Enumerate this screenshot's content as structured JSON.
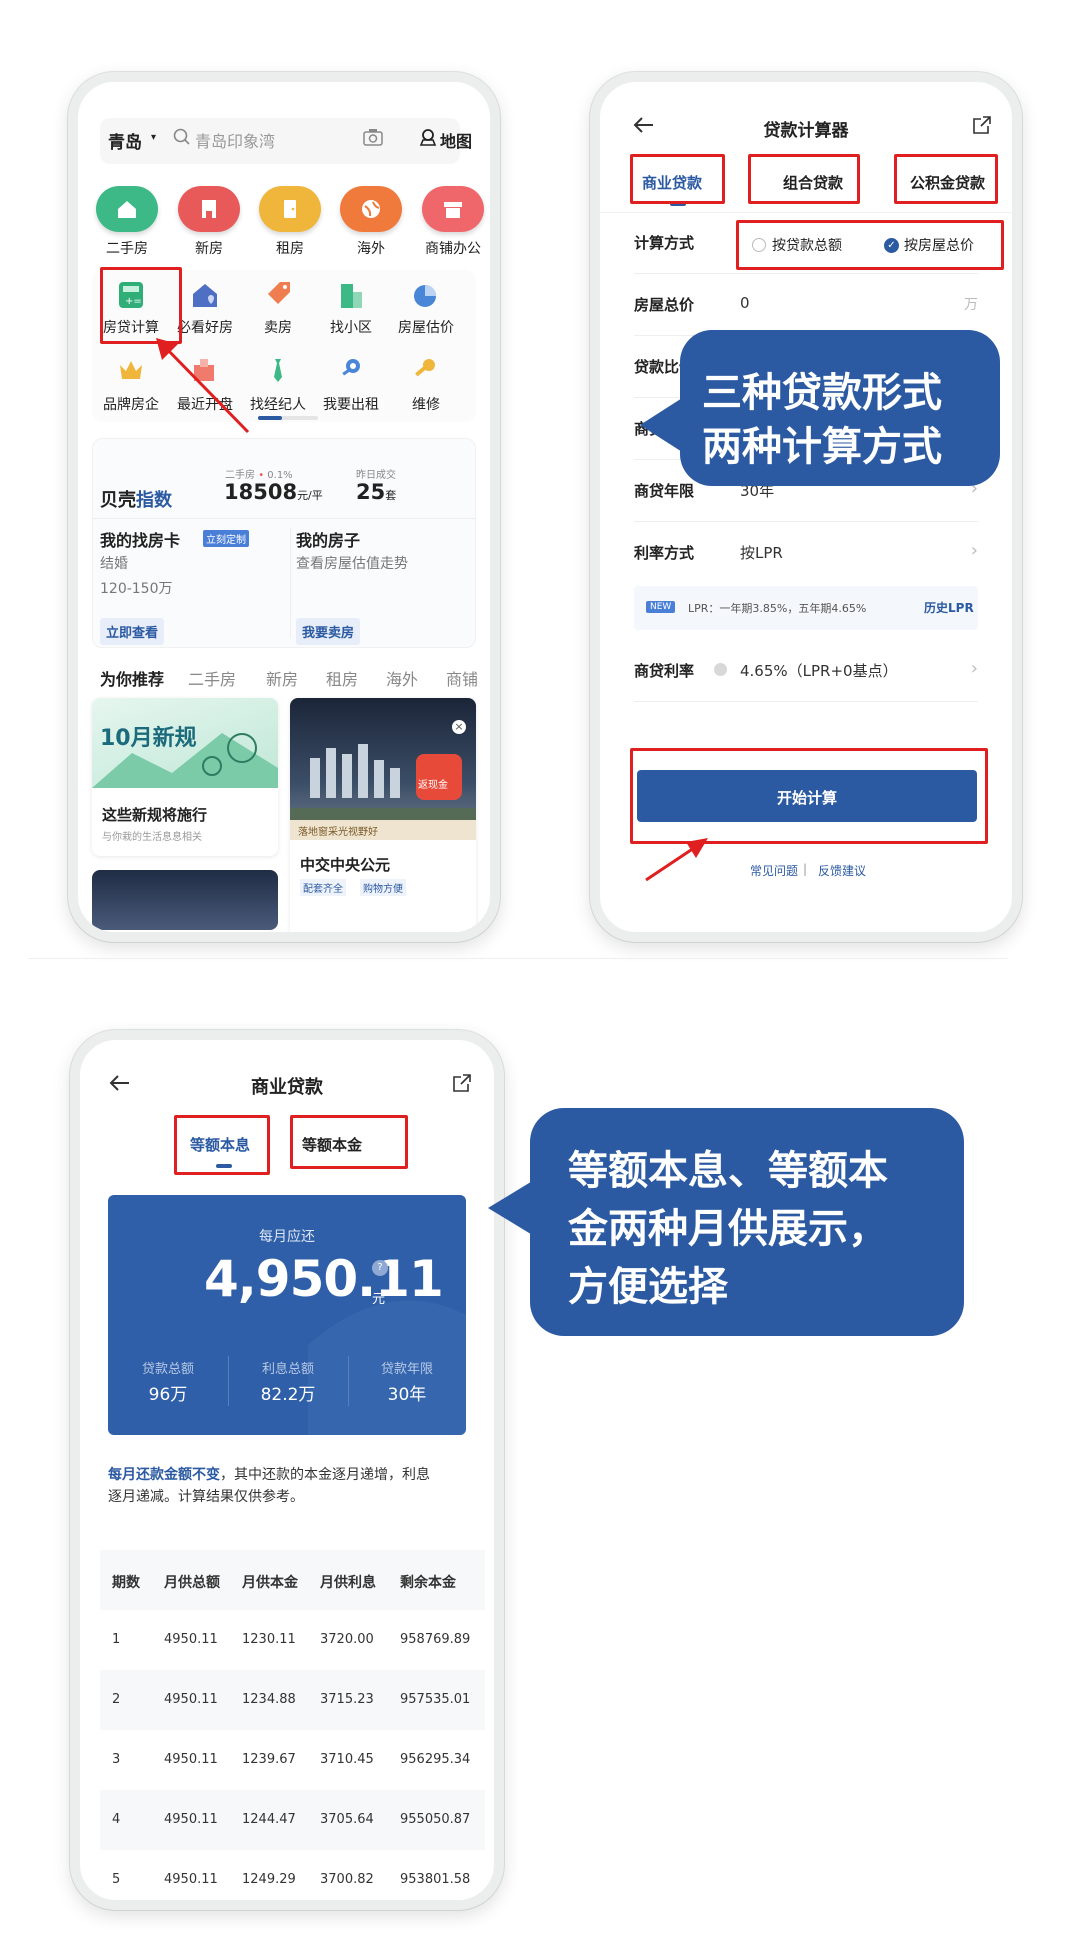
{
  "phone1": {
    "city": "青岛",
    "search_placeholder": "青岛印象湾",
    "map_label": "地图",
    "cats": [
      {
        "label": "二手房",
        "color": "#3db887",
        "icon": "house-icon"
      },
      {
        "label": "新房",
        "color": "#e85a5a",
        "icon": "building-icon"
      },
      {
        "label": "租房",
        "color": "#f0b63c",
        "icon": "door-icon"
      },
      {
        "label": "海外",
        "color": "#f07a3c",
        "icon": "globe-icon"
      },
      {
        "label": "商铺办公",
        "color": "#f0676b",
        "icon": "shop-icon"
      }
    ],
    "tools_row1": [
      {
        "label": "房贷计算",
        "icon": "calculator-icon"
      },
      {
        "label": "必看好房",
        "icon": "heart-house-icon"
      },
      {
        "label": "卖房",
        "icon": "tag-icon"
      },
      {
        "label": "找小区",
        "icon": "community-icon"
      },
      {
        "label": "房屋估价",
        "icon": "pie-chart-icon"
      }
    ],
    "tools_row2": [
      {
        "label": "品牌房企",
        "icon": "crown-icon"
      },
      {
        "label": "最近开盘",
        "icon": "flag-icon"
      },
      {
        "label": "找经纪人",
        "icon": "tie-icon"
      },
      {
        "label": "我要出租",
        "icon": "key-icon"
      },
      {
        "label": "维修",
        "icon": "wrench-icon"
      }
    ],
    "index": {
      "brand": "贝壳",
      "brand_suffix": "指数",
      "secondhand_label": "二手房",
      "secondhand_change": "0.1%",
      "price": "18508",
      "price_unit": "元/平",
      "deals_label": "昨日成交",
      "deals": "25",
      "deals_unit": "套"
    },
    "card_left": {
      "title": "我的找房卡",
      "badge": "立刻定制",
      "line1": "结婚",
      "line2": "120-150万",
      "button": "立即查看"
    },
    "card_right": {
      "title": "我的房子",
      "line1": "查看房屋估值走势",
      "button": "我要卖房"
    },
    "rec_tabs": [
      "为你推荐",
      "二手房",
      "新房",
      "租房",
      "海外",
      "商铺"
    ],
    "feed_left": {
      "banner": "10月新规",
      "title": "这些新规将施行",
      "sub": "与你栽的生活息息相关"
    },
    "feed_right": {
      "badge": "返现金",
      "tagline": "落地窗采光视野好",
      "title": "中交中央公元",
      "tags": [
        "配套齐全",
        "购物方便"
      ]
    }
  },
  "phone2": {
    "title": "贷款计算器",
    "tabs": [
      "商业贷款",
      "组合贷款",
      "公积金贷款"
    ],
    "method_label": "计算方式",
    "method_options": [
      "按贷款总额",
      "按房屋总价"
    ],
    "rows": [
      {
        "label": "房屋总价",
        "value": "0",
        "unit": "万"
      },
      {
        "label": "贷款比例",
        "value": "",
        "unit": ""
      },
      {
        "label": "商贷",
        "value": "",
        "unit": ""
      },
      {
        "label": "商贷年限",
        "value": "30年",
        "unit": ""
      },
      {
        "label": "利率方式",
        "value": "按LPR",
        "unit": ""
      }
    ],
    "lpr_badge": "NEW",
    "lpr_text": "LPR：一年期3.85%，五年期4.65%",
    "lpr_link": "历史LPR",
    "rate_label": "商贷利率",
    "rate_value": "4.65%（LPR+0基点）",
    "start_button": "开始计算",
    "faq": "常见问题",
    "feedback": "反馈建议"
  },
  "callout1": {
    "line1": "三种贷款形式",
    "line2": "两种计算方式"
  },
  "phone3": {
    "title": "商业贷款",
    "tabs": [
      "等额本息",
      "等额本金"
    ],
    "monthly_label": "每月应还",
    "monthly_value": "4,950.11",
    "monthly_unit": "元",
    "stats": [
      {
        "label": "贷款总额",
        "value": "96万"
      },
      {
        "label": "利息总额",
        "value": "82.2万"
      },
      {
        "label": "贷款年限",
        "value": "30年"
      }
    ],
    "note_highlight": "每月还款金额不变",
    "note_rest1": "，其中还款的本金逐月递增，利息",
    "note_rest2": "逐月递减。计算结果仅供参考。",
    "table_headers": [
      "期数",
      "月供总额",
      "月供本金",
      "月供利息",
      "剩余本金"
    ],
    "table_rows": [
      [
        "1",
        "4950.11",
        "1230.11",
        "3720.00",
        "958769.89"
      ],
      [
        "2",
        "4950.11",
        "1234.88",
        "3715.23",
        "957535.01"
      ],
      [
        "3",
        "4950.11",
        "1239.67",
        "3710.45",
        "956295.34"
      ],
      [
        "4",
        "4950.11",
        "1244.47",
        "3705.64",
        "955050.87"
      ],
      [
        "5",
        "4950.11",
        "1249.29",
        "3700.82",
        "953801.58"
      ]
    ]
  },
  "callout2": {
    "line1": "等额本息、等额本",
    "line2": "金两种月供展示，",
    "line3": "方便选择"
  },
  "colors": {
    "accent": "#2b5aa2",
    "red": "#e02020"
  }
}
